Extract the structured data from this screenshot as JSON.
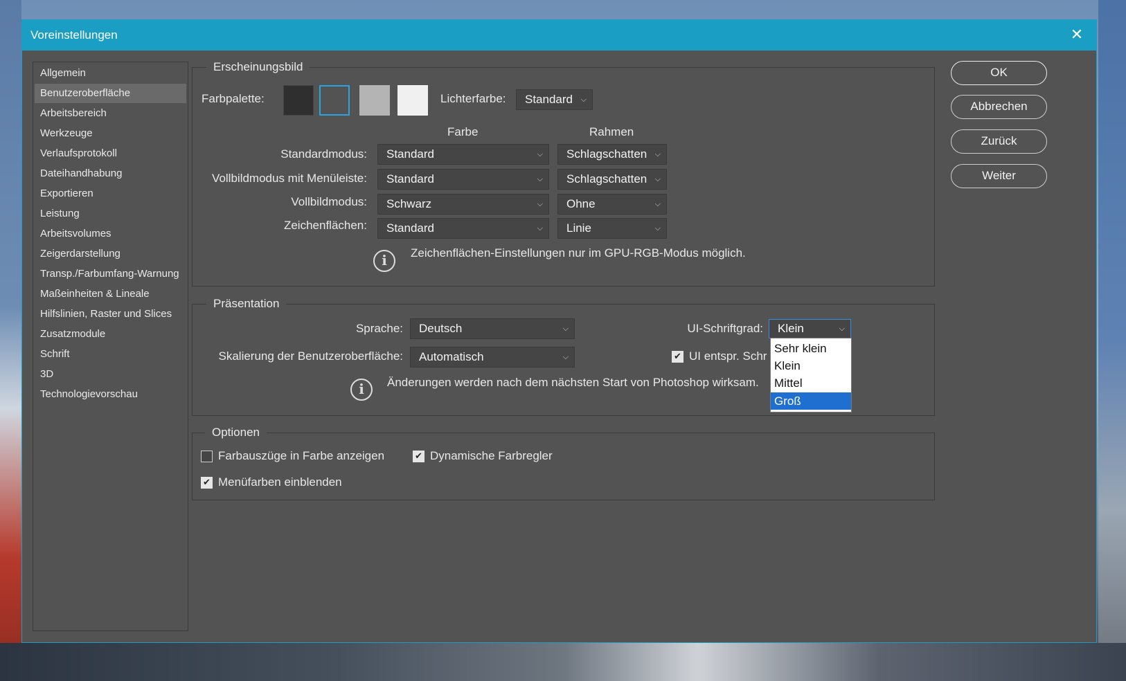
{
  "window": {
    "title": "Voreinstellungen",
    "close_glyph": "✕"
  },
  "sidebar": {
    "items": [
      {
        "label": "Allgemein"
      },
      {
        "label": "Benutzeroberfläche",
        "active": true
      },
      {
        "label": "Arbeitsbereich"
      },
      {
        "label": "Werkzeuge"
      },
      {
        "label": "Verlaufsprotokoll"
      },
      {
        "label": "Dateihandhabung"
      },
      {
        "label": "Exportieren"
      },
      {
        "label": "Leistung"
      },
      {
        "label": "Arbeitsvolumes"
      },
      {
        "label": "Zeigerdarstellung"
      },
      {
        "label": "Transp./Farbumfang-Warnung"
      },
      {
        "label": "Maßeinheiten & Lineale"
      },
      {
        "label": "Hilfslinien, Raster und Slices"
      },
      {
        "label": "Zusatzmodule"
      },
      {
        "label": "Schrift"
      },
      {
        "label": "3D"
      },
      {
        "label": "Technologievorschau"
      }
    ]
  },
  "appearance": {
    "group_title": "Erscheinungsbild",
    "farbpalette_label": "Farbpalette:",
    "swatch_colors": [
      "#2f2f2f",
      "#535353",
      "#b4b4b4",
      "#f0f0f0"
    ],
    "selected_swatch": 1,
    "lichterfarbe_label": "Lichterfarbe:",
    "lichterfarbe_value": "Standard",
    "col_farbe": "Farbe",
    "col_rahmen": "Rahmen",
    "rows": [
      {
        "label": "Standardmodus:",
        "farbe": "Standard",
        "rahmen": "Schlagschatten"
      },
      {
        "label": "Vollbildmodus mit Menüleiste:",
        "farbe": "Standard",
        "rahmen": "Schlagschatten"
      },
      {
        "label": "Vollbildmodus:",
        "farbe": "Schwarz",
        "rahmen": "Ohne"
      },
      {
        "label": "Zeichenflächen:",
        "farbe": "Standard",
        "rahmen": "Linie"
      }
    ],
    "info_text": "Zeichenflächen-Einstellungen nur im GPU-RGB-Modus möglich."
  },
  "presentation": {
    "group_title": "Präsentation",
    "sprache_label": "Sprache:",
    "sprache_value": "Deutsch",
    "skalierung_label": "Skalierung der Benutzeroberfläche:",
    "skalierung_value": "Automatisch",
    "schriftgrad_label": "UI-Schriftgrad:",
    "schriftgrad_value": "Klein",
    "ui_check_label": "UI entspr. Schr",
    "ui_check_checked": true,
    "info_text": "Änderungen werden nach dem nächsten Start von Photoshop wirksam.",
    "dropdown_options": [
      "Sehr klein",
      "Klein",
      "Mittel",
      "Groß"
    ],
    "dropdown_highlighted": "Groß"
  },
  "options": {
    "group_title": "Optionen",
    "farbauszuege_label": "Farbauszüge in Farbe anzeigen",
    "farbauszuege_checked": false,
    "dynamische_label": "Dynamische Farbregler",
    "dynamische_checked": true,
    "menuefarben_label": "Menüfarben einblenden",
    "menuefarben_checked": true
  },
  "buttons": {
    "ok": "OK",
    "abbrechen": "Abbrechen",
    "zurueck": "Zurück",
    "weiter": "Weiter"
  },
  "icons": {
    "chevron": "⌵",
    "check": "✔",
    "info": "i"
  }
}
